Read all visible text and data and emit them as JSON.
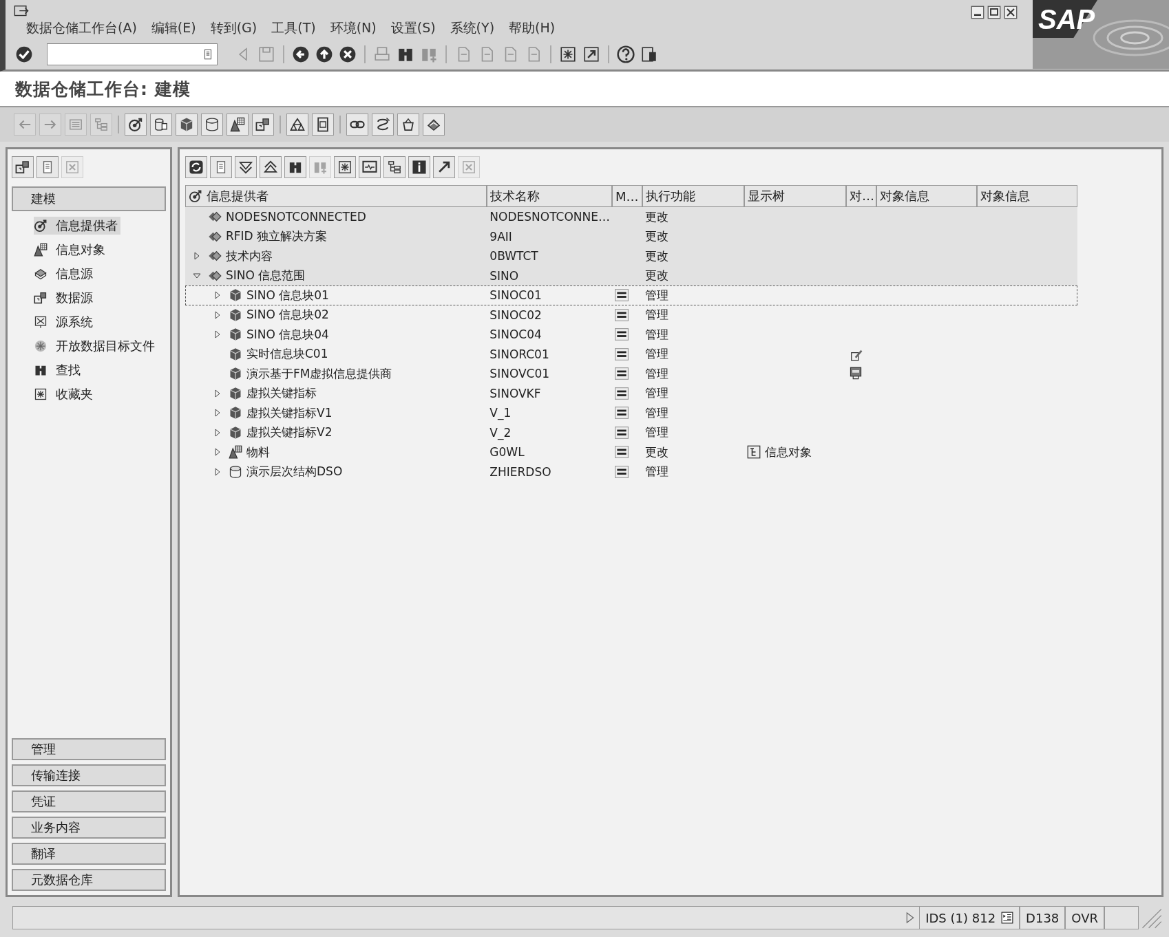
{
  "menu": [
    "数据仓储工作台(A)",
    "编辑(E)",
    "转到(G)",
    "工具(T)",
    "环境(N)",
    "设置(S)",
    "系统(Y)",
    "帮助(H)"
  ],
  "logo": "SAP",
  "standard_toolbar": [
    {
      "kind": "check",
      "disabled": false
    },
    {
      "kind": "field"
    },
    {
      "kind": "tri-left",
      "disabled": true
    },
    {
      "kind": "save",
      "disabled": true
    },
    {
      "kind": "sep"
    },
    {
      "kind": "circle-left",
      "disabled": false
    },
    {
      "kind": "circle-up",
      "disabled": false
    },
    {
      "kind": "circle-x",
      "disabled": false
    },
    {
      "kind": "sep"
    },
    {
      "kind": "print",
      "disabled": true
    },
    {
      "kind": "find",
      "disabled": false
    },
    {
      "kind": "find-next",
      "disabled": true
    },
    {
      "kind": "sep"
    },
    {
      "kind": "page",
      "disabled": true
    },
    {
      "kind": "page",
      "disabled": true
    },
    {
      "kind": "page",
      "disabled": true
    },
    {
      "kind": "page",
      "disabled": true
    },
    {
      "kind": "sep"
    },
    {
      "kind": "new-window",
      "disabled": false
    },
    {
      "kind": "shortcut",
      "disabled": false
    },
    {
      "kind": "sep"
    },
    {
      "kind": "help",
      "disabled": false
    },
    {
      "kind": "layout",
      "disabled": false
    }
  ],
  "title": "数据仓储工作台: 建模",
  "app_toolbar": [
    {
      "kind": "arrow-left",
      "disabled": true
    },
    {
      "kind": "arrow-right",
      "disabled": true
    },
    {
      "kind": "list",
      "disabled": true
    },
    {
      "kind": "tree",
      "disabled": true
    },
    {
      "kind": "sep"
    },
    {
      "kind": "target",
      "disabled": false
    },
    {
      "kind": "cylinder-grid",
      "disabled": false
    },
    {
      "kind": "cube",
      "disabled": false
    },
    {
      "kind": "cylinder",
      "disabled": false
    },
    {
      "kind": "infoobject",
      "disabled": false
    },
    {
      "kind": "datasource",
      "disabled": false
    },
    {
      "kind": "sep"
    },
    {
      "kind": "hierarchy",
      "disabled": false
    },
    {
      "kind": "frame",
      "disabled": false
    },
    {
      "kind": "sep"
    },
    {
      "kind": "link",
      "disabled": false
    },
    {
      "kind": "script",
      "disabled": false
    },
    {
      "kind": "basket",
      "disabled": false
    },
    {
      "kind": "tray",
      "disabled": false
    }
  ],
  "sidebar": {
    "toolbar": [
      {
        "kind": "datasource",
        "disabled": false
      },
      {
        "kind": "doc",
        "disabled": false
      },
      {
        "kind": "close",
        "disabled": true
      }
    ],
    "header": "建模",
    "items": [
      {
        "label": "信息提供者",
        "kind": "target",
        "selected": true
      },
      {
        "label": "信息对象",
        "kind": "infoobject",
        "selected": false
      },
      {
        "label": "信息源",
        "kind": "infosource",
        "selected": false
      },
      {
        "label": "数据源",
        "kind": "datasource",
        "selected": false
      },
      {
        "label": "源系统",
        "kind": "source-system",
        "selected": false
      },
      {
        "label": "开放数据目标文件",
        "kind": "open-hub",
        "selected": false
      },
      {
        "label": "查找",
        "kind": "find",
        "selected": false
      },
      {
        "label": "收藏夹",
        "kind": "favorites",
        "selected": false
      }
    ],
    "sections": [
      "管理",
      "传输连接",
      "凭证",
      "业务内容",
      "翻译",
      "元数据仓库"
    ]
  },
  "tree": {
    "toolbar": [
      {
        "kind": "refresh",
        "disabled": false
      },
      {
        "kind": "doc",
        "disabled": false
      },
      {
        "kind": "expand",
        "disabled": false
      },
      {
        "kind": "collapse",
        "disabled": false
      },
      {
        "kind": "find",
        "disabled": false
      },
      {
        "kind": "find-next",
        "disabled": true
      },
      {
        "kind": "favorites",
        "disabled": false
      },
      {
        "kind": "monitor",
        "disabled": false
      },
      {
        "kind": "tree",
        "disabled": false
      },
      {
        "kind": "info",
        "disabled": false
      },
      {
        "kind": "arrow-out",
        "disabled": false
      },
      {
        "kind": "close",
        "disabled": true
      }
    ],
    "columns": [
      "信息提供者",
      "技术名称",
      "M…",
      "执行功能",
      "显示树",
      "对…",
      "对象信息",
      "对象信息"
    ],
    "rows": [
      {
        "label": "NODESNOTCONNECTED",
        "kind": "area",
        "expandable": false,
        "tech_name": "NODESNOTCONNE…",
        "m_button": false,
        "function": "更改",
        "selected": false
      },
      {
        "label": "RFID 独立解决方案",
        "kind": "area",
        "expandable": false,
        "tech_name": "9AII",
        "m_button": false,
        "function": "更改",
        "selected": false
      },
      {
        "label": "技术内容",
        "kind": "area",
        "expandable": true,
        "expanded": false,
        "tech_name": "0BWTCT",
        "m_button": false,
        "function": "更改",
        "selected": false
      },
      {
        "label": "SINO 信息范围",
        "kind": "area",
        "expandable": true,
        "expanded": true,
        "tech_name": "SINO",
        "m_button": false,
        "function": "更改",
        "selected": false,
        "children": [
          {
            "label": "SINO 信息块01",
            "kind": "cube",
            "expandable": true,
            "expanded": false,
            "tech_name": "SINOC01",
            "m_button": true,
            "function": "管理",
            "selected": true
          },
          {
            "label": "SINO 信息块02",
            "kind": "cube",
            "expandable": true,
            "expanded": false,
            "tech_name": "SINOC02",
            "m_button": true,
            "function": "管理",
            "selected": false
          },
          {
            "label": "SINO 信息块04",
            "kind": "cube",
            "expandable": true,
            "expanded": false,
            "tech_name": "SINOC04",
            "m_button": true,
            "function": "管理",
            "selected": false
          },
          {
            "label": "实时信息块C01",
            "kind": "cube",
            "expandable": false,
            "tech_name": "SINORC01",
            "m_button": true,
            "function": "管理",
            "object_icon": {
              "kind": "edit"
            },
            "selected": false
          },
          {
            "label": "演示基于FM虚拟信息提供商",
            "kind": "cube",
            "expandable": false,
            "tech_name": "SINOVC01",
            "m_button": true,
            "function": "管理",
            "object_icon": {
              "kind": "doc"
            },
            "selected": false
          },
          {
            "label": "虚拟关键指标",
            "kind": "cube",
            "expandable": true,
            "expanded": false,
            "tech_name": "SINOVKF",
            "m_button": true,
            "function": "管理",
            "selected": false
          },
          {
            "label": "虚拟关键指标V1",
            "kind": "cube",
            "expandable": true,
            "expanded": false,
            "tech_name": "V_1",
            "m_button": true,
            "function": "管理",
            "selected": false
          },
          {
            "label": "虚拟关键指标V2",
            "kind": "cube",
            "expandable": true,
            "expanded": false,
            "tech_name": "V_2",
            "m_button": true,
            "function": "管理",
            "selected": false
          },
          {
            "label": "物料",
            "kind": "infoobject",
            "expandable": true,
            "expanded": false,
            "tech_name": "G0WL",
            "m_button": true,
            "function": "更改",
            "display_tree": "信息对象",
            "selected": false
          },
          {
            "label": "演示层次结构DSO",
            "kind": "dso",
            "expandable": true,
            "expanded": false,
            "tech_name": "ZHIERDSO",
            "m_button": true,
            "function": "管理",
            "selected": false
          }
        ]
      }
    ]
  },
  "status_bar": {
    "system": "IDS (1) 812",
    "server": "D138",
    "mode": "OVR"
  }
}
